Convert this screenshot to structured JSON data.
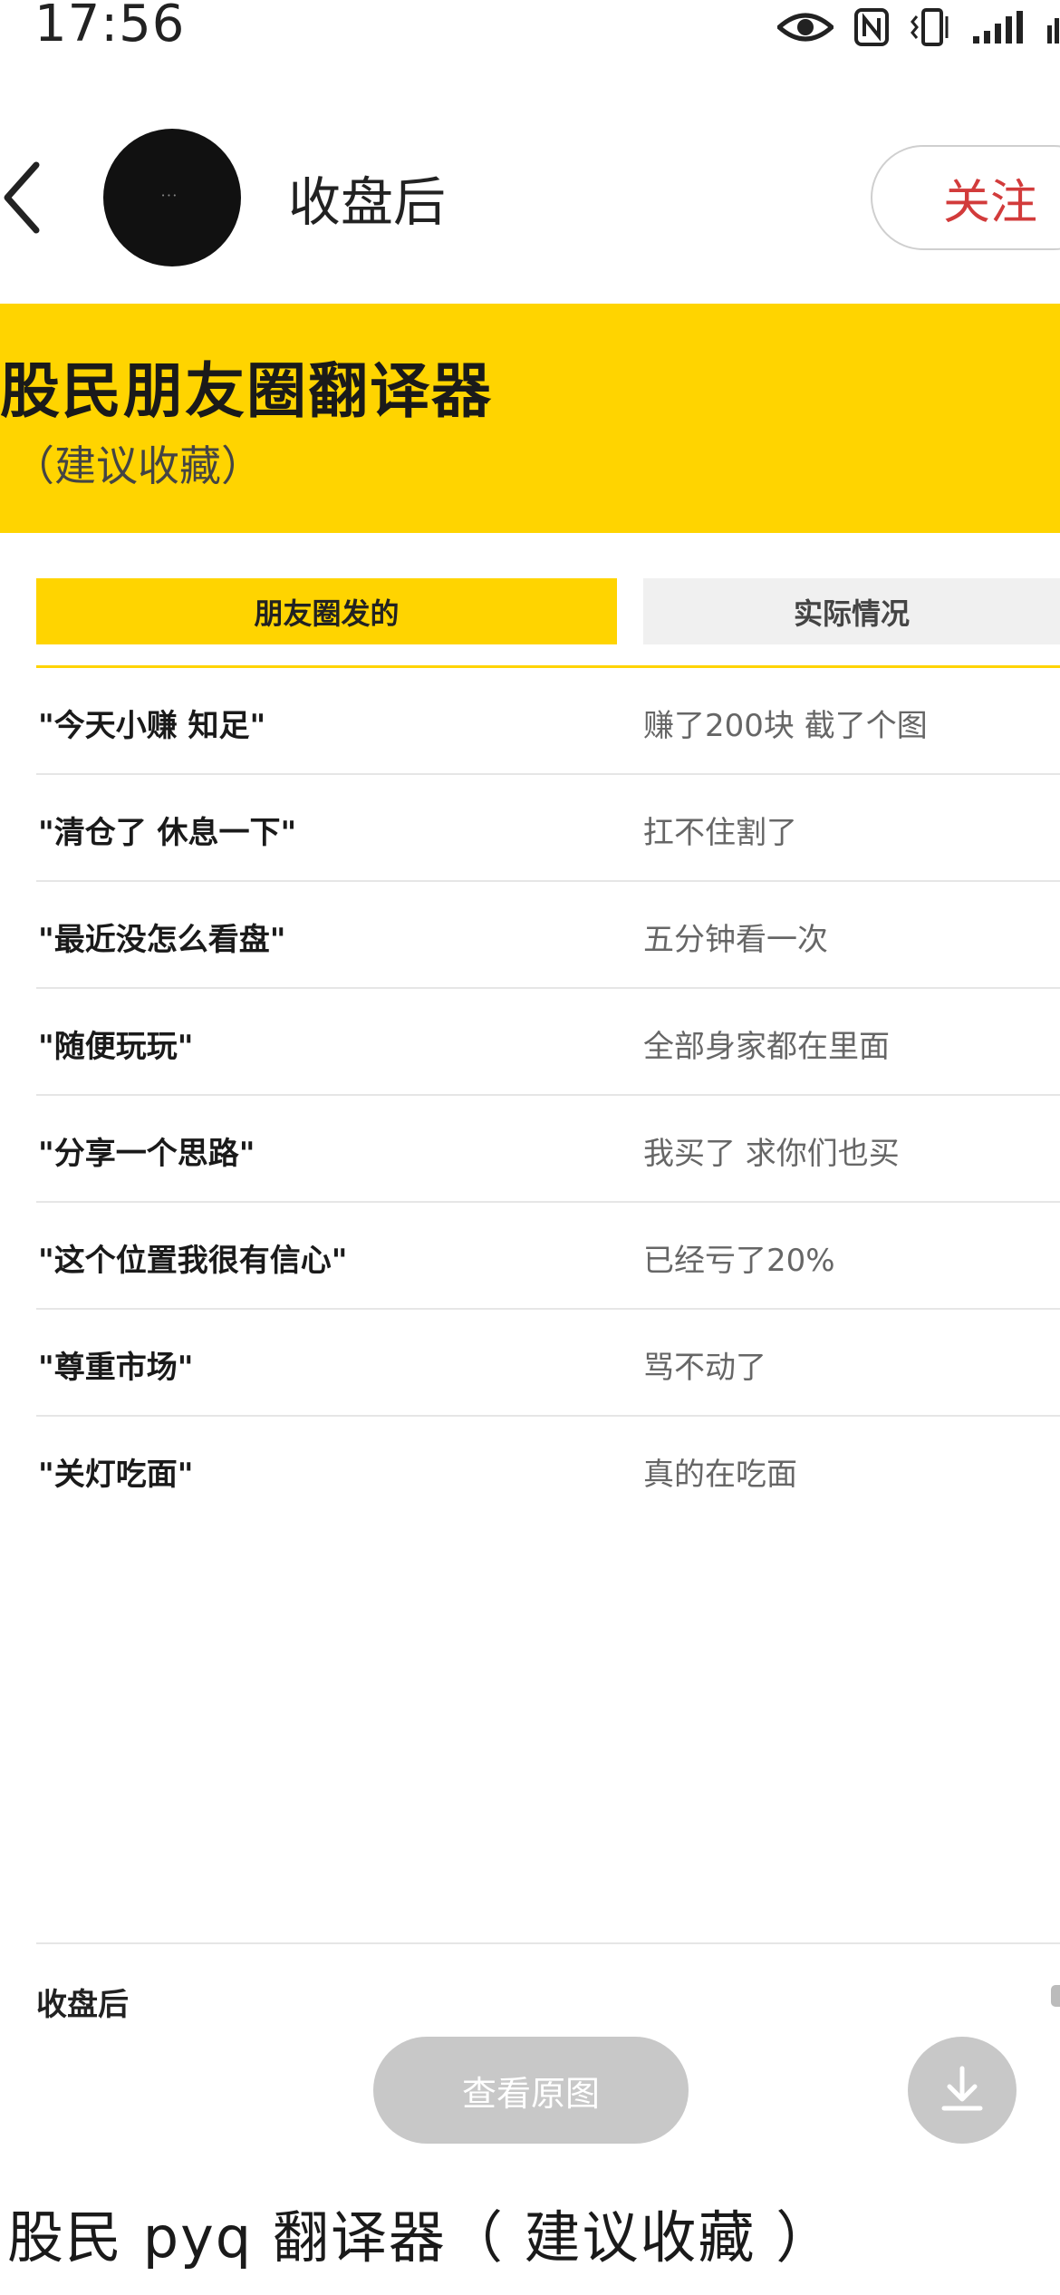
{
  "status_bar": {
    "time": "17:56",
    "icons": [
      "eye-icon",
      "nfc-icon",
      "vibrate-icon",
      "signal-icon",
      "network-icon"
    ]
  },
  "header": {
    "title": "收盘后",
    "follow_label": "关注",
    "back_icon": "chevron-left-icon"
  },
  "banner": {
    "title": "股民朋友圈翻译器",
    "subtitle": "（建议收藏）"
  },
  "table": {
    "headers": [
      "朋友圈发的",
      "实际情况"
    ],
    "rows": [
      {
        "said": "\"今天小赚 知足\"",
        "actual": "赚了200块 截了个图"
      },
      {
        "said": "\"清仓了 休息一下\"",
        "actual": "扛不住割了"
      },
      {
        "said": "\"最近没怎么看盘\"",
        "actual": "五分钟看一次"
      },
      {
        "said": "\"随便玩玩\"",
        "actual": "全部身家都在里面"
      },
      {
        "said": "\"分享一个思路\"",
        "actual": "我买了 求你们也买"
      },
      {
        "said": "\"这个位置我很有信心\"",
        "actual": "已经亏了20%"
      },
      {
        "said": "\"尊重市场\"",
        "actual": "骂不动了"
      },
      {
        "said": "\"关灯吃面\"",
        "actual": "真的在吃面"
      }
    ]
  },
  "footer": {
    "author": "收盘后",
    "view_original_label": "查看原图",
    "download_icon": "download-icon"
  },
  "caption": "股民 pyq 翻译器（ 建议收藏 ）",
  "colors": {
    "accent_yellow": "#ffd400",
    "follow_red": "#d23b3b",
    "button_gray": "#c8c8c8"
  }
}
